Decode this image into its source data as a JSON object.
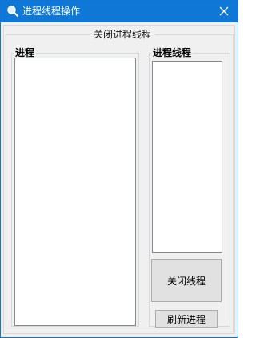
{
  "window": {
    "title": "进程线程操作",
    "accent_color": "#0f78d7"
  },
  "group_main": {
    "title": "关闭进程线程"
  },
  "process_group": {
    "label": "进程"
  },
  "thread_group": {
    "label": "进程线程"
  },
  "buttons": {
    "close_thread": "关闭线程",
    "refresh_process": "刷新进程"
  },
  "icons": {
    "app": "magnifier-icon",
    "close": "close-icon"
  }
}
